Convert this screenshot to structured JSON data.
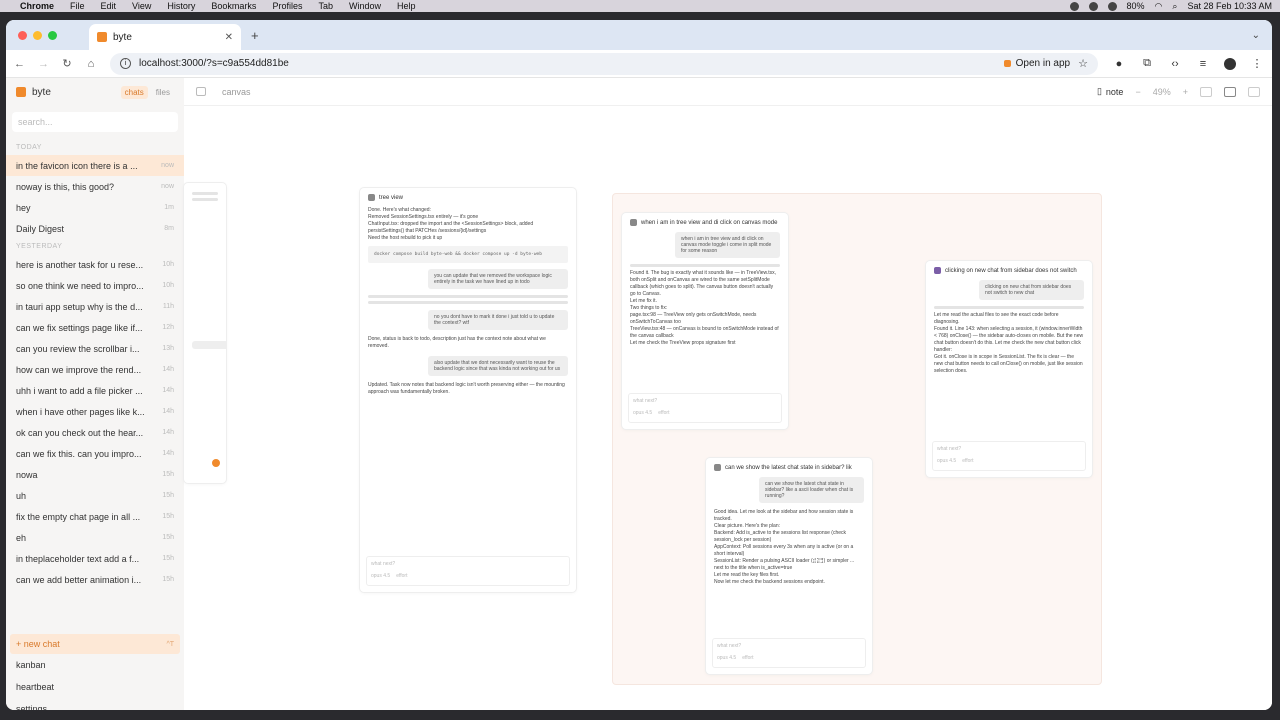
{
  "menubar": {
    "app": "Chrome",
    "items": [
      "File",
      "Edit",
      "View",
      "History",
      "Bookmarks",
      "Profiles",
      "Tab",
      "Window",
      "Help"
    ],
    "battery": "80%",
    "datetime": "Sat 28 Feb  10:33 AM"
  },
  "browser": {
    "tab_title": "byte",
    "url": "localhost:3000/?s=c9a554dd81be",
    "open_in_app": "Open in app"
  },
  "sidebar": {
    "app_name": "byte",
    "seg": [
      "chats",
      "files"
    ],
    "search_placeholder": "search...",
    "groups": [
      {
        "label": "TODAY",
        "items": [
          {
            "title": "in the favicon icon there is a ...",
            "ago": "now"
          },
          {
            "title": "noway is this, this good?",
            "ago": "now"
          },
          {
            "title": "hey",
            "ago": "1m"
          },
          {
            "title": "Daily Digest",
            "ago": "8m"
          }
        ]
      },
      {
        "label": "YESTERDAY",
        "items": [
          {
            "title": "here is another task for u rese...",
            "ago": "10h"
          },
          {
            "title": "so one think we need to impro...",
            "ago": "10h"
          },
          {
            "title": "in tauri app setup why is the d...",
            "ago": "11h"
          },
          {
            "title": "can we fix settings page like if...",
            "ago": "12h"
          },
          {
            "title": "can you review the scrollbar i...",
            "ago": "13h"
          },
          {
            "title": "how can we improve the rend...",
            "ago": "14h"
          },
          {
            "title": "uhh i want to add a file picker ...",
            "ago": "14h"
          },
          {
            "title": "when i have other pages like k...",
            "ago": "14h"
          },
          {
            "title": "ok can you check out the hear...",
            "ago": "14h"
          },
          {
            "title": "can we fix this. can you impro...",
            "ago": "14h"
          },
          {
            "title": "nowa",
            "ago": "15h"
          },
          {
            "title": "uh",
            "ago": "15h"
          },
          {
            "title": "fix the empty chat page in all ...",
            "ago": "15h"
          },
          {
            "title": "eh",
            "ago": "15h"
          },
          {
            "title": "in theplaceholder text add a f...",
            "ago": "15h"
          },
          {
            "title": "can we add better animation i...",
            "ago": "15h"
          }
        ]
      }
    ],
    "new_chat": "+ new chat",
    "new_chat_kbd": "^T",
    "footer": [
      "kanban",
      "heartbeat",
      "settings"
    ]
  },
  "canvas": {
    "label": "canvas",
    "note": "note",
    "zoom": "49%",
    "cards": {
      "tree_view": {
        "title": "tree view",
        "done": "Done. Here's what changed:",
        "b1": "Removed SessionSettings.tsx entirely — it's gone",
        "b2": "ChatInput.tsx: dropped the import and the <SessionSettings> block, added persistSettings() that PATCHes /sessions/{id}/settings",
        "rebuild": "Need the host rebuild to pick it up",
        "cmd": "docker compose build byte-web && docker compose up -d byte-web",
        "u1": "you can update that we removed the workspace logic entirely in the task we have lined up in todo",
        "u2": "no you dont have to mark it done i just told u to update the context? wtf",
        "status": "Done, status is back to todo, description just has the context note about what we removed.",
        "u3": "also update that we dont necessarily want to reuse the backend logic since that was kinda not working out for us",
        "updated": "Updated. Task now notes that backend logic isn't worth preserving either — the mounting approach was fundamentally broken.",
        "placeholder": "what next?",
        "model": "opus 4.5",
        "effort": "effort"
      },
      "tree_click": {
        "title": "when i am in tree view and di click on canvas mode",
        "u1": "when i am in tree view and di click on canvas mode toggle i come in split mode for some reason",
        "found": "Found it. The bug is exactly what it sounds like — in TreeView.tsx, both onSplit and onCanvas are wired to the same setSplitMode callback (which goes to split). The canvas button doesn't actually go to Canvas.",
        "fix": "Let me fix it.",
        "two": "Two things to fix:",
        "f1": "page.tsx:98 — TreeView only gets onSwitchMode, needs onSwitchToCanvas too",
        "f2": "TreeView.tsx:48 — onCanvas is bound to onSwitchMode instead of the canvas callback",
        "check": "Let me check the TreeView props signature first",
        "placeholder": "what next?",
        "model": "opus 4.5",
        "effort": "effort"
      },
      "new_chat": {
        "title": "clicking on new chat from sidebar does not switch",
        "u1": "clicking on new chat from sidebar does not switch to new chat",
        "read": "Let me read the actual files to see the exact code before diagnosing.",
        "found": "Found it. Line 143: when selecting a session, it (window.innerWidth < 768) onClose() — the sidebar auto-closes on mobile. But the new chat button doesn't do this. Let me check the new chat button click handler:",
        "got": "Got it. onClose is in scope in SessionList. The fix is clear — the new chat button needs to call onClose() on mobile, just like session selection does.",
        "placeholder": "what next?",
        "model": "opus 4.5",
        "effort": "effort"
      },
      "latest": {
        "title": "can we show the latest chat state in sidebar? lik",
        "u1": "can we show the latest chat state in sidebar? like a ascii loader when chat is running?",
        "good": "Good idea. Let me look at the sidebar and how session state is tracked.",
        "plan": "Clear picture. Here's the plan:",
        "p1": "Backend: Add is_active to the sessions list response (check session_lock per session)",
        "p2": "AppContext: Poll sessions every 3s when any is active (or on a short interval)",
        "p3": "SessionList: Render a pulsing ASCII loader (⣾⣽⣻) or simpler ... next to the title when is_active=true",
        "key": "Let me read the key files first.",
        "backend": "Now let me check the backend sessions endpoint.",
        "placeholder": "what next?",
        "model": "opus 4.5",
        "effort": "effort"
      }
    }
  },
  "colors": {
    "accent": "#f08a2c",
    "accent_bg": "#fde8d6",
    "sidebar_bg": "#f6f5f4"
  }
}
